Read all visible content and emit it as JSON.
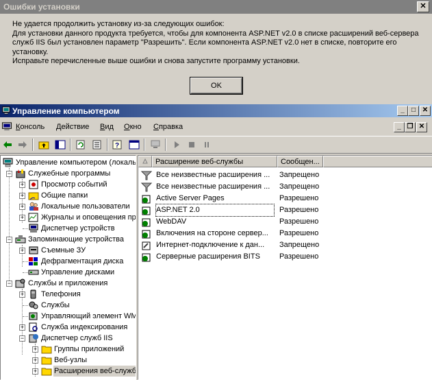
{
  "dialog": {
    "title": "Ошибки установки",
    "close_glyph": "✕",
    "lines": [
      "Не удается продолжить установку из-за следующих ошибок:",
      "Для установки данного продукта требуется, чтобы для компонента ASP.NET v2.0 в списке расширений веб-сервера",
      "служб IIS был установлен параметр \"Разрешить\". Если компонента ASP.NET v2.0 нет в списке, повторите его",
      "установку.",
      "Исправьте перечисленные выше ошибки и снова запустите программу установки."
    ],
    "ok_label": "OK"
  },
  "window": {
    "title": "Управление компьютером",
    "buttons": {
      "minimize": "_",
      "maximize": "□",
      "close": "✕"
    }
  },
  "menubar": {
    "items": [
      {
        "hot": "К",
        "rest": "онсоль"
      },
      {
        "hot": "Д",
        "rest": "ействие"
      },
      {
        "hot": "В",
        "rest": "ид"
      },
      {
        "hot": "О",
        "rest": "кно"
      },
      {
        "hot": "С",
        "rest": "правка"
      }
    ],
    "child_buttons": {
      "minimize": "_",
      "restore": "❐",
      "close": "✕"
    }
  },
  "tree": {
    "items": [
      {
        "label": "Управление компьютером (локаль",
        "icon": "computer-icon"
      },
      {
        "label": "Служебные программы",
        "icon": "tools-icon"
      },
      {
        "label": "Просмотр событий",
        "icon": "event-viewer-icon"
      },
      {
        "label": "Общие папки",
        "icon": "shared-folder-icon"
      },
      {
        "label": "Локальные пользователи",
        "icon": "users-icon"
      },
      {
        "label": "Журналы и оповещения пр",
        "icon": "performance-logs-icon"
      },
      {
        "label": "Диспетчер устройств",
        "icon": "device-manager-icon"
      },
      {
        "label": "Запоминающие устройства",
        "icon": "storage-icon"
      },
      {
        "label": "Съемные ЗУ",
        "icon": "removable-storage-icon"
      },
      {
        "label": "Дефрагментация диска",
        "icon": "defrag-icon"
      },
      {
        "label": "Управление дисками",
        "icon": "disk-management-icon"
      },
      {
        "label": "Службы и приложения",
        "icon": "services-apps-icon"
      },
      {
        "label": "Телефония",
        "icon": "telephony-icon"
      },
      {
        "label": "Службы",
        "icon": "services-icon"
      },
      {
        "label": "Управляющий элемент WM",
        "icon": "wmi-icon"
      },
      {
        "label": "Служба индексирования",
        "icon": "indexing-icon"
      },
      {
        "label": "Диспетчер служб IIS",
        "icon": "iis-icon"
      },
      {
        "label": "Группы приложений",
        "icon": "folder-icon"
      },
      {
        "label": "Веб-узлы",
        "icon": "folder-icon"
      },
      {
        "label": "Расширения веб-служб",
        "icon": "folder-icon"
      }
    ]
  },
  "list": {
    "columns": [
      "Расширение веб-службы",
      "Сообщен..."
    ],
    "rows": [
      {
        "name": "Все неизвестные расширения ...",
        "status": "Запрещено",
        "icon": "funnel-icon"
      },
      {
        "name": "Все неизвестные расширения ...",
        "status": "Запрещено",
        "icon": "funnel-icon"
      },
      {
        "name": "Active Server Pages",
        "status": "Разрешено",
        "icon": "web-extension-icon"
      },
      {
        "name": "ASP.NET 2.0",
        "status": "Разрешено",
        "icon": "web-extension-icon"
      },
      {
        "name": "WebDAV",
        "status": "Разрешено",
        "icon": "web-extension-icon"
      },
      {
        "name": "Включения на стороне сервер...",
        "status": "Разрешено",
        "icon": "web-extension-icon"
      },
      {
        "name": "Интернет-подключение к дан...",
        "status": "Запрещено",
        "icon": "blocked-extension-icon"
      },
      {
        "name": "Серверные расширения BITS",
        "status": "Разрешено",
        "icon": "web-extension-icon"
      }
    ]
  },
  "colors": {
    "window_face": "#d4d0c8",
    "active_title_start": "#0a246a",
    "active_title_end": "#a6caf0",
    "inactive_title": "#808080"
  }
}
